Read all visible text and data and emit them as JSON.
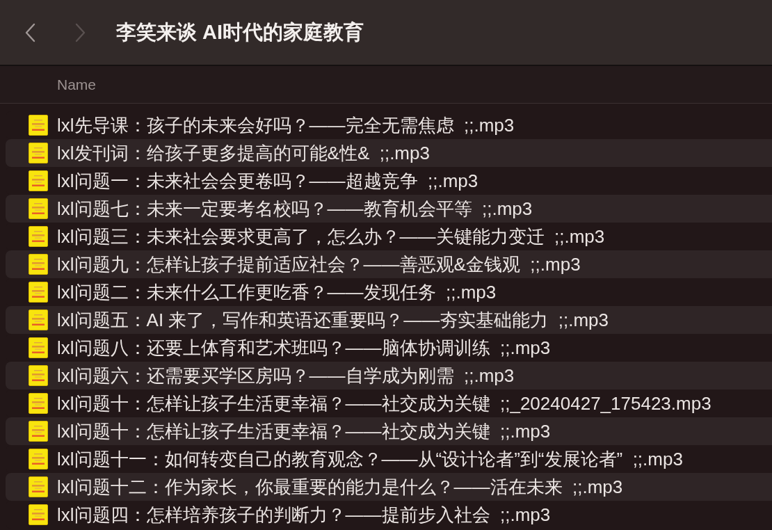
{
  "window": {
    "title": "李笑来谈 AI时代的家庭教育"
  },
  "navigation": [
    {
      "kind": "back",
      "disabled": false
    },
    {
      "kind": "forward",
      "disabled": true
    }
  ],
  "table": {
    "columns": [
      {
        "label": "Name"
      }
    ],
    "rows": [
      {
        "name": "lxl先导课：孩子的未来会好吗？——完全无需焦虑  ;;.mp3"
      },
      {
        "name": "lxl发刊词：给孩子更多提高的可能&性&  ;;.mp3"
      },
      {
        "name": "lxl问题一：未来社会会更卷吗？——超越竞争  ;;.mp3"
      },
      {
        "name": "lxl问题七：未来一定要考名校吗？——教育机会平等  ;;.mp3"
      },
      {
        "name": "lxl问题三：未来社会要求更高了，怎么办？——关键能力变迁  ;;.mp3"
      },
      {
        "name": "lxl问题九：怎样让孩子提前适应社会？——善恶观&金钱观  ;;.mp3"
      },
      {
        "name": "lxl问题二：未来什么工作更吃香？——发现任务  ;;.mp3"
      },
      {
        "name": "lxl问题五：AI 来了，写作和英语还重要吗？——夯实基础能力  ;;.mp3"
      },
      {
        "name": "lxl问题八：还要上体育和艺术班吗？——脑体协调训练  ;;.mp3"
      },
      {
        "name": "lxl问题六：还需要买学区房吗？——自学成为刚需  ;;.mp3"
      },
      {
        "name": "lxl问题十：怎样让孩子生活更幸福？——社交成为关键  ;;_20240427_175423.mp3"
      },
      {
        "name": "lxl问题十：怎样让孩子生活更幸福？——社交成为关键  ;;.mp3"
      },
      {
        "name": "lxl问题十一：如何转变自己的教育观念？——从“设计论者”到“发展论者”  ;;.mp3"
      },
      {
        "name": "lxl问题十二：作为家长，你最重要的能力是什么？——活在未来  ;;.mp3"
      },
      {
        "name": "lxl问题四：怎样培养孩子的判断力？——提前步入社会  ;;.mp3"
      }
    ]
  }
}
